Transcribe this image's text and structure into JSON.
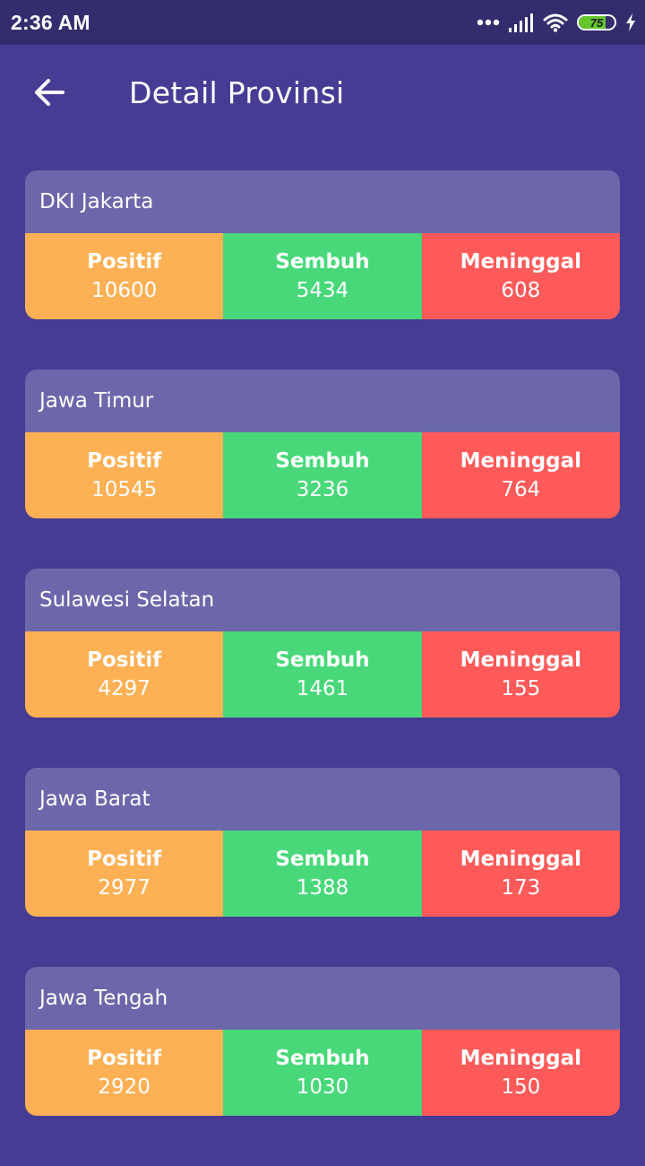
{
  "status_bar": {
    "time": "2:36 AM",
    "battery_level": "75",
    "battery_fraction": 0.75,
    "icons": [
      "dots-icon",
      "signal-icon",
      "wifi-icon",
      "battery-icon",
      "charging-icon"
    ]
  },
  "header": {
    "back_icon": "arrow-left-icon",
    "title": "Detail Provinsi"
  },
  "colors": {
    "background": "#463c94",
    "status_bar": "#322e6e",
    "card_header": "#6c67aa",
    "positif": "#feb055",
    "sembuh": "#48d879",
    "meninggal": "#fe5a59"
  },
  "labels": {
    "positif": "Positif",
    "sembuh": "Sembuh",
    "meninggal": "Meninggal"
  },
  "provinces": [
    {
      "name": "DKI Jakarta",
      "positif": "10600",
      "sembuh": "5434",
      "meninggal": "608"
    },
    {
      "name": "Jawa Timur",
      "positif": "10545",
      "sembuh": "3236",
      "meninggal": "764"
    },
    {
      "name": "Sulawesi Selatan",
      "positif": "4297",
      "sembuh": "1461",
      "meninggal": "155"
    },
    {
      "name": "Jawa Barat",
      "positif": "2977",
      "sembuh": "1388",
      "meninggal": "173"
    },
    {
      "name": "Jawa Tengah",
      "positif": "2920",
      "sembuh": "1030",
      "meninggal": "150"
    }
  ]
}
